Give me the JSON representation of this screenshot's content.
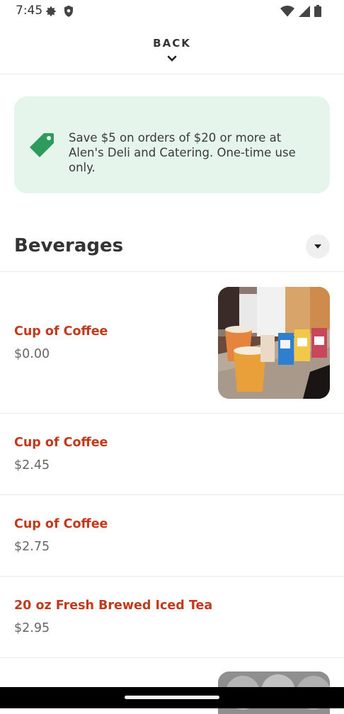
{
  "status_bar": {
    "time": "7:45",
    "icons": [
      "gear-icon",
      "shield-icon",
      "wifi-icon",
      "cellular-signal-icon",
      "battery-icon"
    ]
  },
  "header": {
    "back_label": "BACK",
    "back_icon": "chevron-down-icon"
  },
  "promo": {
    "icon": "price-tag-icon",
    "text": "Save $5 on orders of $20 or more at Alen's Deli and Catering. One-time use only.",
    "background_color": "#e5f5ec",
    "icon_color": "#2e9a5c"
  },
  "section": {
    "title": "Beverages",
    "toggle_icon": "caret-down-icon"
  },
  "items": [
    {
      "name": "Cup of Coffee",
      "price": "$0.00",
      "has_photo": true
    },
    {
      "name": "Cup of Coffee",
      "price": "$2.45",
      "has_photo": false
    },
    {
      "name": "Cup of Coffee",
      "price": "$2.75",
      "has_photo": false
    },
    {
      "name": "20 oz Fresh Brewed Iced Tea",
      "price": "$2.95",
      "has_photo": false
    }
  ],
  "colors": {
    "item_name": "#c23a1c",
    "item_price": "#666666"
  }
}
